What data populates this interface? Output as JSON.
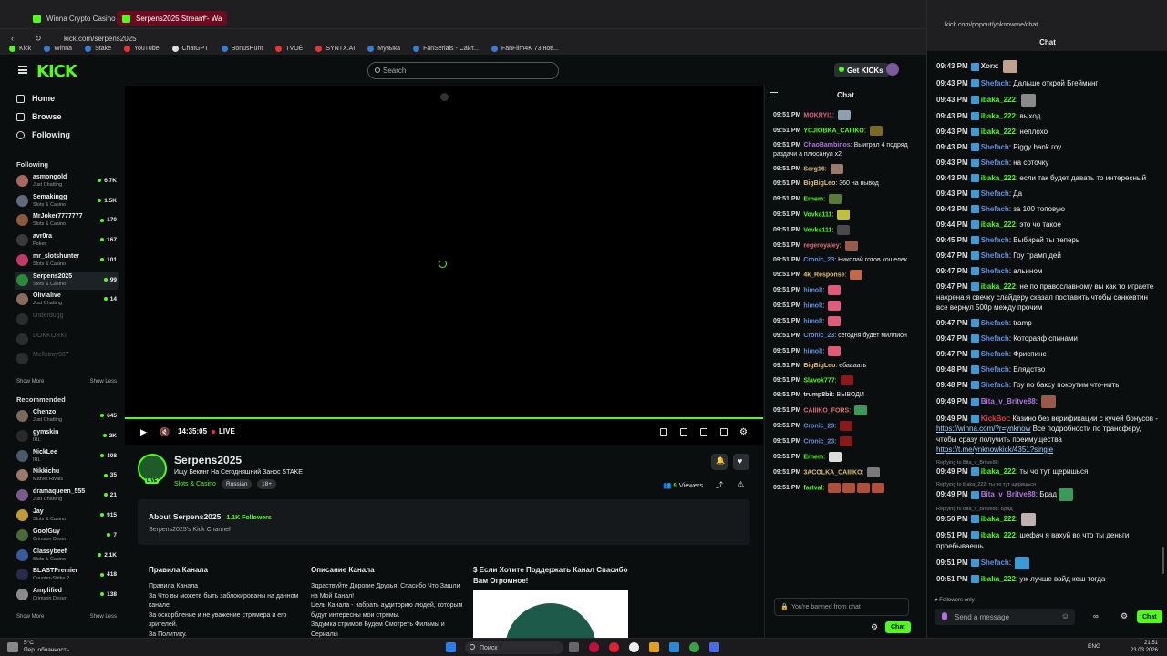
{
  "browser": {
    "tabs": [
      {
        "label": "Winna Crypto Casino - Be"
      },
      {
        "label": "Serpens2025 Stream - Wa"
      }
    ],
    "url": "kick.com/serpens2025",
    "bookmarks": [
      "Kick",
      "Winna",
      "Stake",
      "YouTube",
      "ChatGPT",
      "BonusHunt",
      "TVOЁ",
      "SYNTX.AI",
      "Музыка",
      "FanSerials - Сайт...",
      "FanFilm4K 73 нов..."
    ]
  },
  "header": {
    "logo": "KICK",
    "search_placeholder": "Search",
    "get_kicks": "Get KICKs"
  },
  "sidebar": {
    "nav": [
      {
        "label": "Home"
      },
      {
        "label": "Browse"
      },
      {
        "label": "Following"
      }
    ],
    "following_title": "Following",
    "following": [
      {
        "name": "asmongold",
        "cat": "Just Chatting",
        "count": "6.7K",
        "color": "#a8685f"
      },
      {
        "name": "Semakingg",
        "cat": "Slots & Casino",
        "count": "1.5K",
        "color": "#5f6a7a"
      },
      {
        "name": "MrJoker7777777",
        "cat": "Slots & Casino",
        "count": "170",
        "color": "#8a5a3a"
      },
      {
        "name": "avr0ra",
        "cat": "Poker",
        "count": "167",
        "color": "#3a3a3a"
      },
      {
        "name": "mr_slotshunter",
        "cat": "Slots & Casino",
        "count": "101",
        "color": "#c03a6a"
      },
      {
        "name": "Serpens2025",
        "cat": "Slots & Casino",
        "count": "99",
        "color": "#2a8a3a"
      },
      {
        "name": "Olivialive",
        "cat": "Just Chatting",
        "count": "14",
        "color": "#8a6a5a"
      },
      {
        "name": "underd0gg",
        "cat": "",
        "count": "",
        "color": "#6a6a6a"
      },
      {
        "name": "DOKKORKI",
        "cat": "",
        "count": "",
        "color": "#6a6a6a"
      },
      {
        "name": "Mellstroy987",
        "cat": "",
        "count": "",
        "color": "#6a6a6a"
      }
    ],
    "show_more": "Show More",
    "show_less": "Show Less",
    "recommended_title": "Recommended",
    "recommended": [
      {
        "name": "Chenzo",
        "cat": "Just Chatting",
        "count": "645",
        "color": "#7a6a5a"
      },
      {
        "name": "gymskin",
        "cat": "IRL",
        "count": "2K",
        "color": "#2a2a2a"
      },
      {
        "name": "NickLee",
        "cat": "IRL",
        "count": "408",
        "color": "#4a5a6a"
      },
      {
        "name": "Nikkichu",
        "cat": "Marvel Rivals",
        "count": "35",
        "color": "#9a7a6a"
      },
      {
        "name": "dramaqueen_555",
        "cat": "Just Chatting",
        "count": "21",
        "color": "#7a5a8a"
      },
      {
        "name": "Jay",
        "cat": "Slots & Casino",
        "count": "915",
        "color": "#c09a3a"
      },
      {
        "name": "GoofGuy",
        "cat": "Crimson Desert",
        "count": "7",
        "color": "#4a6a3a"
      },
      {
        "name": "Classybeef",
        "cat": "Slots & Casino",
        "count": "2.1K",
        "color": "#3a5a9a"
      },
      {
        "name": "BLASTPremier",
        "cat": "Counter-Strike 2",
        "count": "418",
        "color": "#2a2a4a"
      },
      {
        "name": "Amplified",
        "cat": "Crimson Desert",
        "count": "138",
        "color": "#8a8a8a"
      }
    ]
  },
  "player": {
    "time": "14:35:05",
    "live": "LIVE"
  },
  "channel": {
    "name": "Serpens2025",
    "live_badge": "LIVE",
    "title": "Ищу Бекинг На Сегодняшний Занос STAKE",
    "category": "Slots & Casino",
    "tags": [
      "Russian",
      "18+"
    ],
    "viewers_count": "9",
    "viewers_label": "Viewers",
    "about_title": "About Serpens2025",
    "followers": "1.1K Followers",
    "about_sub": "Serpens2025's Kick Channel",
    "panels": [
      {
        "title": "Правила Канала",
        "body": "Правила Канала\nЗа Что вы можете быть заблокированы на данном канале.\nЗа оскорбление и не уважение стримера и его зрителей.\nЗа Политику."
      },
      {
        "title": "Описание Канала",
        "body": "Здраствуйте Дорогие Друзья! Спасибо Что Зашли на Мой Канал!\nЦель Канала - набрать аудиторию людей, которым будут интересны мои стримы.\nЗадумка стримов Будем Смотреть Фильмы и Сериалы"
      },
      {
        "title": "$ Если Хотите Поддержать Канал Спасибо Вам Огромное!",
        "body": ""
      }
    ]
  },
  "chat": {
    "title": "Chat",
    "messages": [
      {
        "ts": "09:51 PM",
        "user": "MOKRYI1",
        "color": "#e0607a",
        "text": "",
        "emo": "#8fa0b0"
      },
      {
        "ts": "09:51 PM",
        "user": "YCJIOBKA_CAIIIKO",
        "color": "#53fc18",
        "text": "",
        "emo": "#7a6a2a"
      },
      {
        "ts": "09:51 PM",
        "user": "ChaoBambinos",
        "color": "#b070e0",
        "text": "Выиграл 4 подряд раздачи а плюсанул х2",
        "emo": ""
      },
      {
        "ts": "09:51 PM",
        "user": "Serg16",
        "color": "#e0c070",
        "text": "",
        "emo": "#9a7a6a"
      },
      {
        "ts": "09:51 PM",
        "user": "BigBigLeo",
        "color": "#e0c070",
        "text": "360 на вывод",
        "emo": ""
      },
      {
        "ts": "09:51 PM",
        "user": "Ernem",
        "color": "#53fc18",
        "text": "",
        "emo": "#5a7a3a"
      },
      {
        "ts": "09:51 PM",
        "user": "Vovka111",
        "color": "#53fc18",
        "text": "",
        "emo": "#c0c03a"
      },
      {
        "ts": "09:51 PM",
        "user": "Vovka111",
        "color": "#53fc18",
        "text": "",
        "emo": "#4a4a4a"
      },
      {
        "ts": "09:51 PM",
        "user": "regeroyaley",
        "color": "#e07070",
        "text": "",
        "emo": "#9a5a4a"
      },
      {
        "ts": "09:51 PM",
        "user": "Cronic_23",
        "color": "#6090e0",
        "text": "Николай готов кошелек",
        "emo": ""
      },
      {
        "ts": "09:51 PM",
        "user": "4k_Response",
        "color": "#e0c070",
        "text": "",
        "emo": "#c06a4a"
      },
      {
        "ts": "09:51 PM",
        "user": "himolt",
        "color": "#6090e0",
        "text": "",
        "emo": "#e05a7a"
      },
      {
        "ts": "09:51 PM",
        "user": "himolt",
        "color": "#6090e0",
        "text": "",
        "emo": "#e05a7a"
      },
      {
        "ts": "09:51 PM",
        "user": "himolt",
        "color": "#6090e0",
        "text": "",
        "emo": "#e05a7a"
      },
      {
        "ts": "09:51 PM",
        "user": "Cronic_23",
        "color": "#6090e0",
        "text": "сегодня будет миллион",
        "emo": ""
      },
      {
        "ts": "09:51 PM",
        "user": "himolt",
        "color": "#6090e0",
        "text": "",
        "emo": "#e05a7a"
      },
      {
        "ts": "09:51 PM",
        "user": "BigBigLeo",
        "color": "#e0c070",
        "text": "ебаааать",
        "emo": ""
      },
      {
        "ts": "09:51 PM",
        "user": "Slavok777",
        "color": "#53fc18",
        "text": "",
        "emo": "#8a1a1a"
      },
      {
        "ts": "09:51 PM",
        "user": "trump8bit",
        "color": "#ddd",
        "text": "ВЫВОДИ",
        "emo": ""
      },
      {
        "ts": "09:51 PM",
        "user": "CAIIIKO_FORS",
        "color": "#e07070",
        "text": "",
        "emo": "#3a9a5a"
      },
      {
        "ts": "09:51 PM",
        "user": "Cronic_23",
        "color": "#6090e0",
        "text": "",
        "emo": "#8a1a1a"
      },
      {
        "ts": "09:51 PM",
        "user": "Cronic_23",
        "color": "#6090e0",
        "text": "",
        "emo": "#8a1a1a"
      },
      {
        "ts": "09:51 PM",
        "user": "Ernem",
        "color": "#53fc18",
        "text": "",
        "emo": "#ddd"
      },
      {
        "ts": "09:51 PM",
        "user": "3ACOLKA_CAIIIKO",
        "color": "#e0c070",
        "text": "",
        "emo": "#7a7a7a"
      },
      {
        "ts": "09:51 PM",
        "user": "fartval",
        "color": "#53fc18",
        "text": "",
        "emo": "#b0503a"
      }
    ],
    "banned": "You're banned from chat",
    "chat_button": "Chat"
  },
  "popout": {
    "url": "kick.com/popout/ynknowme/chat",
    "title": "Chat",
    "messages": [
      {
        "ts": "09:43 PM",
        "user": "Xorx",
        "color": "#ddd",
        "text": "",
        "emo": "#c0a090",
        "reply": ""
      },
      {
        "ts": "09:43 PM",
        "user": "Shefach",
        "color": "#6090e0",
        "text": "Дальше открой Бгейминг",
        "emo": "",
        "reply": ""
      },
      {
        "ts": "09:43 PM",
        "user": "ibaka_222",
        "color": "#53fc18",
        "text": "",
        "emo": "#8a8a8a",
        "reply": ""
      },
      {
        "ts": "09:43 PM",
        "user": "ibaka_222",
        "color": "#53fc18",
        "text": "выход",
        "emo": "",
        "reply": ""
      },
      {
        "ts": "09:43 PM",
        "user": "ibaka_222",
        "color": "#53fc18",
        "text": "неплохо",
        "emo": "",
        "reply": ""
      },
      {
        "ts": "09:43 PM",
        "user": "Shefach",
        "color": "#6090e0",
        "text": "Piggy bank гоу",
        "emo": "",
        "reply": ""
      },
      {
        "ts": "09:43 PM",
        "user": "Shefach",
        "color": "#6090e0",
        "text": "на соточку",
        "emo": "",
        "reply": ""
      },
      {
        "ts": "09:43 PM",
        "user": "ibaka_222",
        "color": "#53fc18",
        "text": "если так будет давать то интересный",
        "emo": "",
        "reply": ""
      },
      {
        "ts": "09:43 PM",
        "user": "Shefach",
        "color": "#6090e0",
        "text": "Да",
        "emo": "",
        "reply": ""
      },
      {
        "ts": "09:43 PM",
        "user": "Shefach",
        "color": "#6090e0",
        "text": "за 100 топовую",
        "emo": "",
        "reply": ""
      },
      {
        "ts": "09:44 PM",
        "user": "ibaka_222",
        "color": "#53fc18",
        "text": "это чо такое",
        "emo": "",
        "reply": ""
      },
      {
        "ts": "09:45 PM",
        "user": "Shefach",
        "color": "#6090e0",
        "text": "Выбирай ты теперь",
        "emo": "",
        "reply": ""
      },
      {
        "ts": "09:47 PM",
        "user": "Shefach",
        "color": "#6090e0",
        "text": "Гоу трамп дей",
        "emo": "",
        "reply": ""
      },
      {
        "ts": "09:47 PM",
        "user": "Shefach",
        "color": "#6090e0",
        "text": "альином",
        "emo": "",
        "reply": ""
      },
      {
        "ts": "09:47 PM",
        "user": "ibaka_222",
        "color": "#53fc18",
        "text": "не по православному вы как то играете нахрена я свечку слайдеру сказал поставить чтобы санкевтин все вернул 500р между прочим",
        "emo": "",
        "reply": ""
      },
      {
        "ts": "09:47 PM",
        "user": "Shefach",
        "color": "#6090e0",
        "text": "tramp",
        "emo": "",
        "reply": ""
      },
      {
        "ts": "09:47 PM",
        "user": "Shefach",
        "color": "#6090e0",
        "text": "Котораяф спинами",
        "emo": "",
        "reply": ""
      },
      {
        "ts": "09:47 PM",
        "user": "Shefach",
        "color": "#6090e0",
        "text": "Фриспинс",
        "emo": "",
        "reply": ""
      },
      {
        "ts": "09:48 PM",
        "user": "Shefach",
        "color": "#6090e0",
        "text": "Блядство",
        "emo": "",
        "reply": ""
      },
      {
        "ts": "09:48 PM",
        "user": "Shefach",
        "color": "#6090e0",
        "text": "Гоу по баксу покрутим что-нить",
        "emo": "",
        "reply": ""
      },
      {
        "ts": "09:49 PM",
        "user": "Bita_v_Britve88",
        "color": "#b070e0",
        "text": "",
        "emo": "#9a5a4a",
        "reply": ""
      },
      {
        "ts": "09:49 PM",
        "user": "KickBot",
        "color": "#e04040",
        "text": "Казино без верификации с кучей бонусов -",
        "link": "https://winna.com/?r=ynknow",
        "text2": "Все подробности по трансферу, чтобы сразу получить преимущества",
        "link2": "https://t.me/ynknowkick/4351?single",
        "emo": "",
        "reply": ""
      },
      {
        "ts": "09:49 PM",
        "user": "ibaka_222",
        "color": "#53fc18",
        "text": "ты чо тут щеришься",
        "emo": "",
        "reply": "Replying to Bita_v_Britve88:"
      },
      {
        "ts": "09:49 PM",
        "user": "Bita_v_Britve88",
        "color": "#b070e0",
        "text": "Брад",
        "emo": "#3a9a5a",
        "reply": "Replying to ibaka_222: ты чо тут щеришься"
      },
      {
        "ts": "09:50 PM",
        "user": "ibaka_222",
        "color": "#53fc18",
        "text": "",
        "emo": "#c0b0b0",
        "reply": "Replying to Bita_v_Britve88: Брад"
      },
      {
        "ts": "09:51 PM",
        "user": "ibaka_222",
        "color": "#53fc18",
        "text": "шефач я вахуй во что ты деньги проебываешь",
        "emo": "",
        "reply": ""
      },
      {
        "ts": "09:51 PM",
        "user": "Shefach",
        "color": "#6090e0",
        "text": "",
        "emo": "#3b9bd6",
        "reply": ""
      },
      {
        "ts": "09:51 PM",
        "user": "ibaka_222",
        "color": "#53fc18",
        "text": "уж лучше вайд кеш тогда",
        "emo": "",
        "reply": ""
      }
    ],
    "followers_only": "Followers only",
    "send_placeholder": "Send a message",
    "chat_button": "Chat"
  },
  "taskbar": {
    "temp": "5°C",
    "weather": "Пер. облачность",
    "search": "Поиск",
    "lang": "ENG",
    "time": "21:51",
    "date": "23.03.2026"
  }
}
